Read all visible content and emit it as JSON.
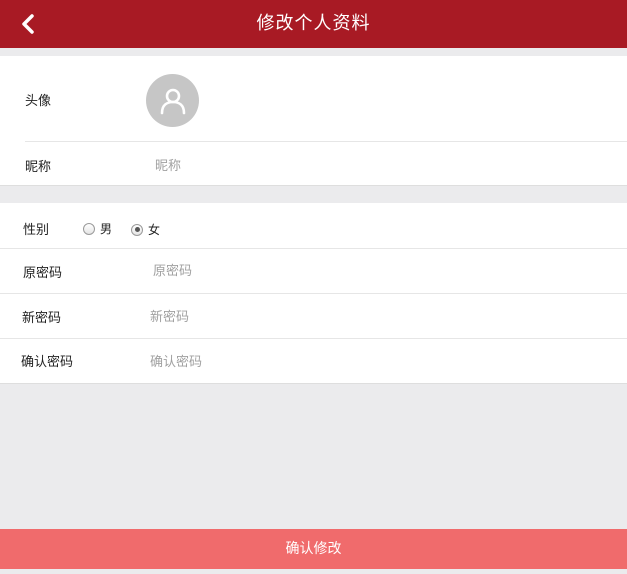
{
  "header": {
    "title": "修改个人资料",
    "back_icon": "chevron-left-icon"
  },
  "profile": {
    "avatar_label": "头像",
    "avatar_icon": "user-icon",
    "nickname_label": "昵称",
    "nickname_placeholder": "昵称",
    "nickname_value": ""
  },
  "account": {
    "gender_label": "性别",
    "gender_options": [
      {
        "label": "男",
        "checked": false
      },
      {
        "label": "女",
        "checked": true
      }
    ],
    "old_password_label": "原密码",
    "old_password_placeholder": "原密码",
    "new_password_label": "新密码",
    "new_password_placeholder": "新密码",
    "confirm_password_label": "确认密码",
    "confirm_password_placeholder": "确认密码"
  },
  "submit_label": "确认修改",
  "colors": {
    "header": "#a81a24",
    "submit": "#f06b6c",
    "background": "#ebebed"
  }
}
